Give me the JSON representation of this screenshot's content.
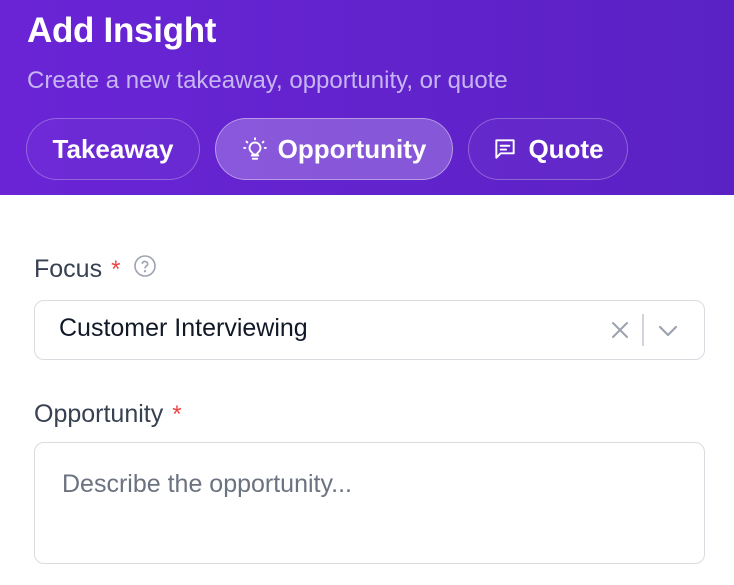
{
  "header": {
    "title": "Add Insight",
    "subtitle": "Create a new takeaway, opportunity, or quote",
    "tabs": [
      {
        "label": "Takeaway",
        "icon": "none",
        "active": false
      },
      {
        "label": "Opportunity",
        "icon": "lightbulb-icon",
        "active": true
      },
      {
        "label": "Quote",
        "icon": "message-square-icon",
        "active": false
      }
    ]
  },
  "form": {
    "focus": {
      "label": "Focus",
      "required_marker": "*",
      "value": "Customer Interviewing"
    },
    "opportunity": {
      "label": "Opportunity",
      "required_marker": "*",
      "placeholder": "Describe the opportunity..."
    }
  },
  "colors": {
    "header_gradient_start": "#6a24d6",
    "header_gradient_end": "#5a22c4",
    "required": "#ef4444",
    "label": "#374151",
    "input_border": "#d8dbe0"
  }
}
